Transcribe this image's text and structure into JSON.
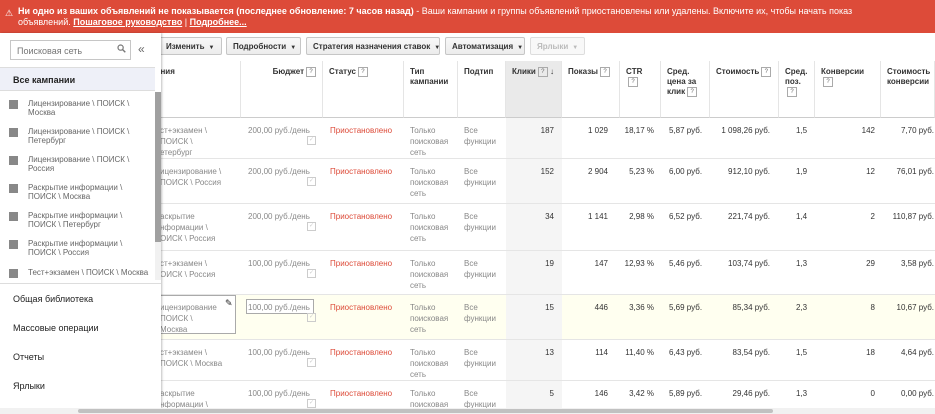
{
  "alert": {
    "bold": "Ни одно из ваших объявлений не показывается (последнее обновление: 7 часов назад)",
    "text_line1": " - Ваши кампании и группы объявлений приостановлены или удалены. Включите их, чтобы начать показ",
    "text_line2": "объявлений.",
    "link_guide": "Пошаговое руководство",
    "sep": "|",
    "link_more": "Подробнее..."
  },
  "toolbar": {
    "edit": "Изменить",
    "details": "Подробности",
    "bid_strategy": "Стратегия назначения ставок",
    "automation": "Автоматизация",
    "labels": "Ярлыки"
  },
  "sidebar": {
    "search_placeholder": "Поисковая сеть",
    "all_campaigns": "Все кампании",
    "campaigns": [
      {
        "l1": "Лицензирование \\ ПОИСК \\",
        "l2": "Москва"
      },
      {
        "l1": "Лицензирование \\ ПОИСК \\",
        "l2": "Петербург"
      },
      {
        "l1": "Лицензирование \\ ПОИСК \\",
        "l2": "Россия"
      },
      {
        "l1": "Раскрытие информации \\",
        "l2": "ПОИСК \\ Москва"
      },
      {
        "l1": "Раскрытие информации \\",
        "l2": "ПОИСК \\ Петербург"
      },
      {
        "l1": "Раскрытие информации \\",
        "l2": "ПОИСК \\ Россия"
      },
      {
        "l1": "Тест+экзамен \\ ПОИСК \\ Москва",
        "l2": ""
      }
    ],
    "nav": [
      "Общая библиотека",
      "Массовые операции",
      "Отчеты",
      "Ярлыки"
    ]
  },
  "headers": {
    "name": "ания",
    "budget": "Бюджет",
    "status": "Статус",
    "type_l1": "Тип",
    "type_l2": "кампании",
    "subtype": "Подтип",
    "clicks": "Клики",
    "sort_arrow": "↓",
    "impr": "Показы",
    "ctr": "CTR",
    "cpc_l1": "Сред.",
    "cpc_l2": "цена за",
    "cpc_l3": "клик",
    "cost": "Стоимость",
    "pos_l1": "Сред.",
    "pos_l2": "поз.",
    "conv": "Конверсии",
    "cpconv_l1": "Стоимость",
    "cpconv_l2": "конверсии"
  },
  "rows": [
    {
      "name": [
        "ст+экзамен \\",
        "ПОИСК \\",
        "етербург"
      ],
      "budget": "200,00 руб./день",
      "status": "Приостановлено",
      "type": [
        "Только",
        "поисковая",
        "сеть"
      ],
      "subtype": [
        "Все",
        "функции"
      ],
      "clicks": "187",
      "impr": "1 029",
      "ctr": "18,17 %",
      "cpc": "5,87 руб.",
      "cost": "1 098,26 руб.",
      "pos": "1,5",
      "conv": "142",
      "cpconv": "7,70 руб."
    },
    {
      "name": [
        "ицензирование \\",
        "ПОИСК \\ Россия"
      ],
      "budget": "200,00 руб./день",
      "status": "Приостановлено",
      "type": [
        "Только",
        "поисковая",
        "сеть"
      ],
      "subtype": [
        "Все",
        "функции"
      ],
      "clicks": "152",
      "impr": "2 904",
      "ctr": "5,23 %",
      "cpc": "6,00 руб.",
      "cost": "912,10 руб.",
      "pos": "1,9",
      "conv": "12",
      "cpconv": "76,01 руб."
    },
    {
      "name": [
        "аскрытие",
        "нформации \\",
        "ОИСК \\ Россия"
      ],
      "budget": "200,00 руб./день",
      "status": "Приостановлено",
      "type": [
        "Только",
        "поисковая",
        "сеть"
      ],
      "subtype": [
        "Все",
        "функции"
      ],
      "clicks": "34",
      "impr": "1 141",
      "ctr": "2,98 %",
      "cpc": "6,52 руб.",
      "cost": "221,74 руб.",
      "pos": "1,4",
      "conv": "2",
      "cpconv": "110,87 руб."
    },
    {
      "name": [
        "ст+экзамен \\",
        "ОИСК \\ Россия"
      ],
      "budget": "100,00 руб./день",
      "status": "Приостановлено",
      "type": [
        "Только",
        "поисковая",
        "сеть"
      ],
      "subtype": [
        "Все",
        "функции"
      ],
      "clicks": "19",
      "impr": "147",
      "ctr": "12,93 %",
      "cpc": "5,46 руб.",
      "cost": "103,74 руб.",
      "pos": "1,3",
      "conv": "29",
      "cpconv": "3,58 руб."
    },
    {
      "name": [
        "ицензирование",
        "ПОИСК \\",
        "Москва"
      ],
      "budget": "100,00 руб./день",
      "status": "Приостановлено",
      "type": [
        "Только",
        "поисковая",
        "сеть"
      ],
      "subtype": [
        "Все",
        "функции"
      ],
      "clicks": "15",
      "impr": "446",
      "ctr": "3,36 %",
      "cpc": "5,69 руб.",
      "cost": "85,34 руб.",
      "pos": "2,3",
      "conv": "8",
      "cpconv": "10,67 руб."
    },
    {
      "name": [
        "ст+экзамен \\",
        "ПОИСК \\ Москва"
      ],
      "budget": "100,00 руб./день",
      "status": "Приостановлено",
      "type": [
        "Только",
        "поисковая",
        "сеть"
      ],
      "subtype": [
        "Все",
        "функции"
      ],
      "clicks": "13",
      "impr": "114",
      "ctr": "11,40 %",
      "cpc": "6,43 руб.",
      "cost": "83,54 руб.",
      "pos": "1,5",
      "conv": "18",
      "cpconv": "4,64 руб."
    },
    {
      "name": [
        "аскрытие",
        "нформации \\"
      ],
      "budget": "100,00 руб./день",
      "status": "Приостановлено",
      "type": [
        "Только",
        "поисковая"
      ],
      "subtype": [
        "Все",
        "функции"
      ],
      "clicks": "5",
      "impr": "146",
      "ctr": "3,42 %",
      "cpc": "5,89 руб.",
      "cost": "29,46 руб.",
      "pos": "1,3",
      "conv": "0",
      "cpconv": "0,00 руб."
    }
  ],
  "colors": {
    "alert": "#dd4b39",
    "status_paused": "#dd4b39",
    "highlight_row": "#fffff0"
  },
  "icons": [
    "warning-icon",
    "search-icon",
    "collapse-icon",
    "campaign-icon",
    "pencil-icon",
    "sort-down-icon",
    "help-icon"
  ]
}
